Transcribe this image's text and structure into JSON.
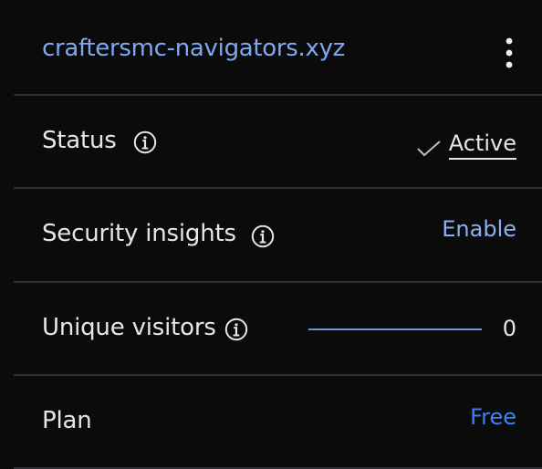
{
  "header": {
    "domain": "craftersmc-navigators.xyz",
    "menu_icon": "more-vertical-icon"
  },
  "rows": {
    "status": {
      "label": "Status",
      "info_icon": "info-icon",
      "check_icon": "check-icon",
      "value": "Active"
    },
    "security": {
      "label": "Security insights",
      "info_icon": "info-icon",
      "action": "Enable"
    },
    "visitors": {
      "label": "Unique visitors",
      "info_icon": "info-icon",
      "value": "0"
    },
    "plan": {
      "label": "Plan",
      "value": "Free"
    }
  },
  "colors": {
    "background": "#0b0b0c",
    "divider": "#2f2f33",
    "link": "#7fa8f0",
    "plan": "#3b82f6",
    "sparkline": "#6f96d6",
    "text": "#e6e6e6"
  }
}
